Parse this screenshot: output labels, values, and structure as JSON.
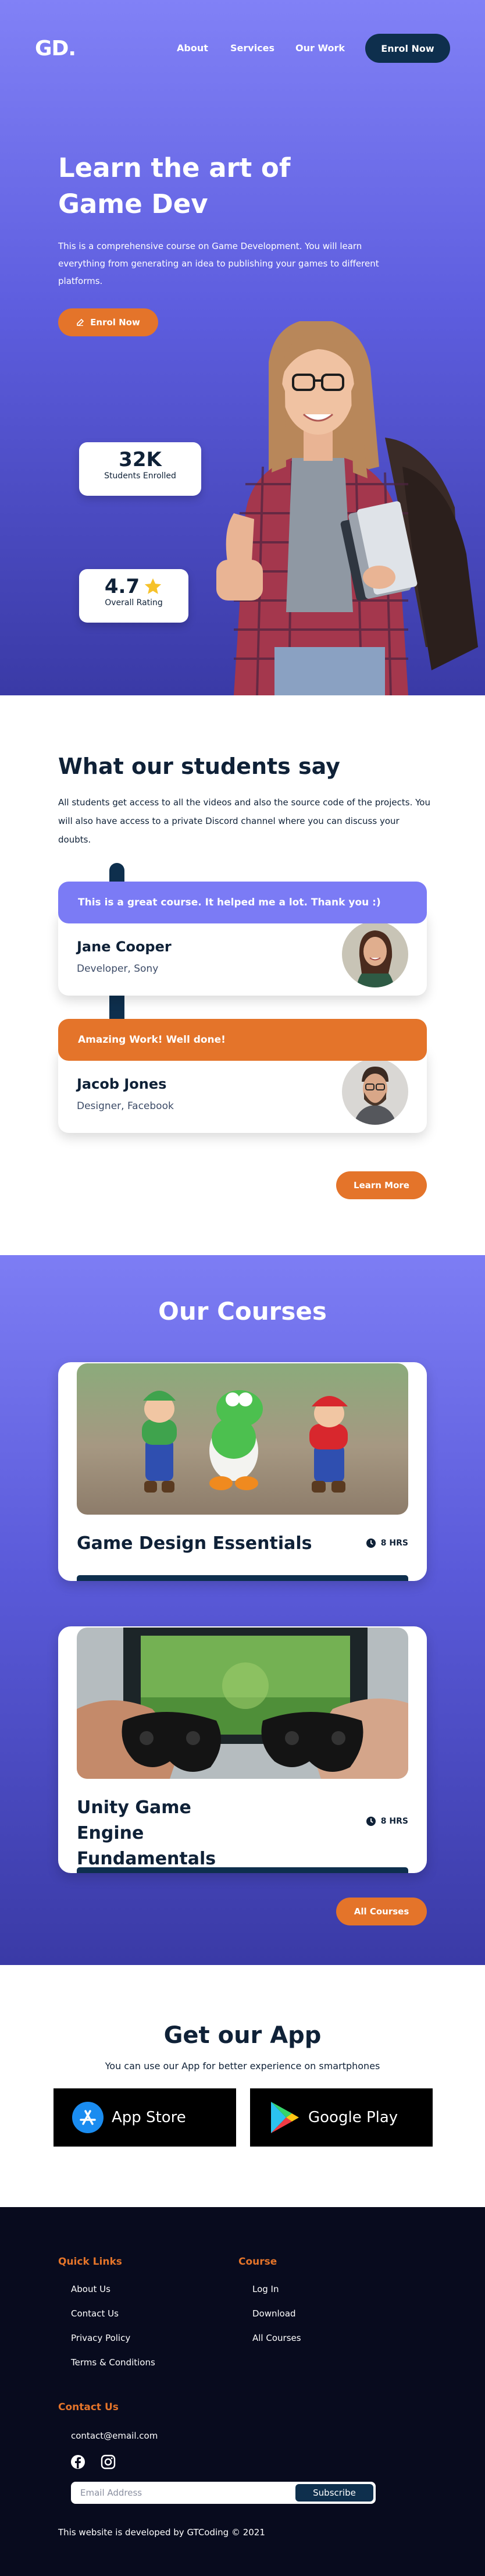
{
  "nav": {
    "logo": "GD.",
    "links": [
      "About",
      "Services",
      "Our Work"
    ],
    "cta": "Enrol Now"
  },
  "hero": {
    "title": "Learn the art of Game Dev",
    "description": "This is a comprehensive course on Game Development. You will learn everything from generating an idea to publishing your games to different platforms.",
    "button": "Enrol Now",
    "stats": {
      "students_value": "32K",
      "students_label": "Students Enrolled",
      "rating_value": "4.7",
      "rating_label": "Overall Rating"
    }
  },
  "testimonials": {
    "title": "What our students say",
    "description": "All students get access to all the videos and also the source code of the projects. You will also have access to a private Discord channel where you can discuss your doubts.",
    "items": [
      {
        "quote": "This is a great course. It helped me a lot. Thank you :)",
        "name": "Jane Cooper",
        "role": "Developer, Sony",
        "color": "#7b7bf5"
      },
      {
        "quote": "Amazing Work! Well done!",
        "name": "Jacob Jones",
        "role": "Designer, Facebook",
        "color": "#e4742a"
      }
    ],
    "button": "Learn More"
  },
  "courses": {
    "title": "Our Courses",
    "items": [
      {
        "name": "Game Design Essentials",
        "hours": "8 HRS"
      },
      {
        "name": "Unity Game Engine Fundamentals",
        "hours": "8 HRS"
      }
    ],
    "button": "All Courses"
  },
  "app": {
    "title": "Get our App",
    "description": "You can use our App for better experience on smartphones",
    "stores": [
      "App Store",
      "Google Play"
    ]
  },
  "footer": {
    "quick_links_title": "Quick Links",
    "quick_links": [
      "About Us",
      "Contact Us",
      "Privacy Policy",
      "Terms & Conditions"
    ],
    "course_title": "Course",
    "course_links": [
      "Log In",
      "Download",
      "All Courses"
    ],
    "contact_title": "Contact Us",
    "email": "contact@email.com",
    "social_icons": [
      "facebook-icon",
      "instagram-icon"
    ],
    "newsletter_placeholder": "Email Address",
    "subscribe": "Subscribe",
    "copyright": "This website is developed by GTCoding © 2021"
  },
  "colors": {
    "accent_orange": "#e4742a",
    "navy": "#0e2f4d",
    "purple": "#7b7bf5",
    "footer_bg": "#080b1e"
  }
}
